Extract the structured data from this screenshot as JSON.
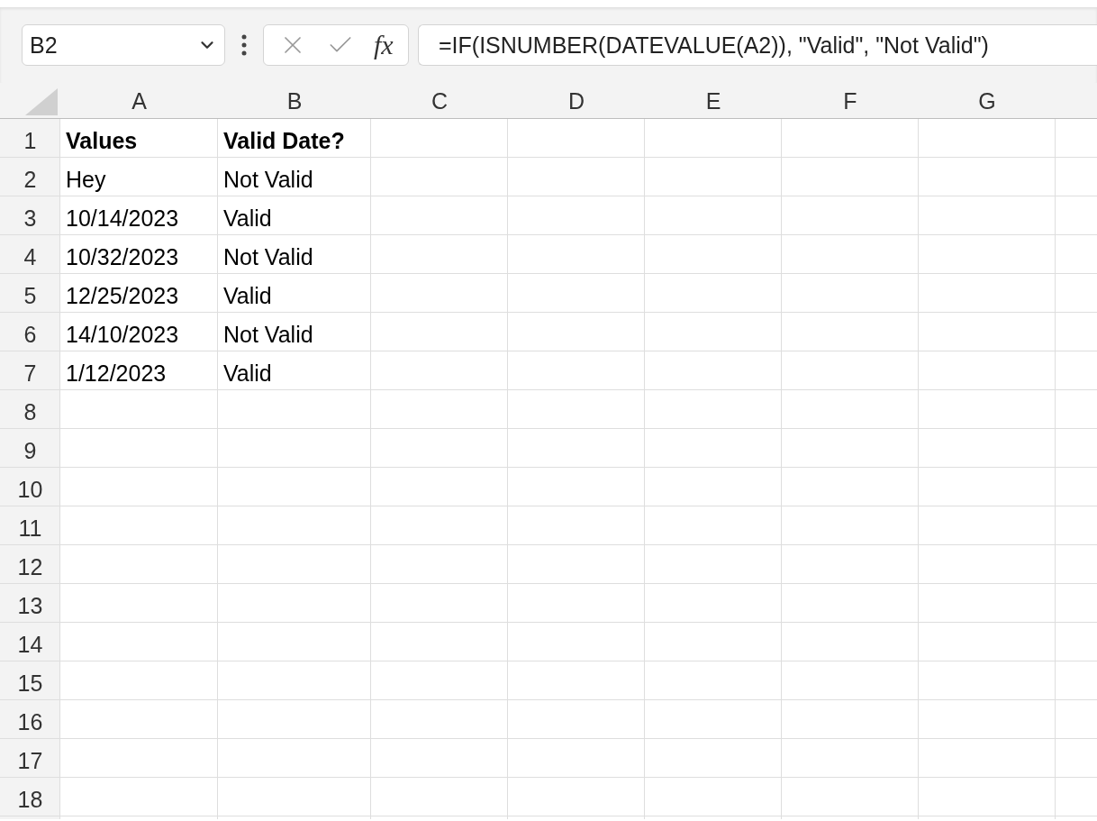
{
  "name_box": {
    "value": "B2"
  },
  "formula_bar": {
    "fx": "fx",
    "value": "=IF(ISNUMBER(DATEVALUE(A2)), \"Valid\", \"Not Valid\")"
  },
  "columns": [
    "A",
    "B",
    "C",
    "D",
    "E",
    "F",
    "G"
  ],
  "rows": [
    {
      "header": "1",
      "cells": [
        {
          "text": "Values",
          "bold": true
        },
        {
          "text": "Valid Date?",
          "bold": true
        }
      ]
    },
    {
      "header": "2",
      "cells": [
        {
          "text": "Hey",
          "bold": false
        },
        {
          "text": "Not Valid",
          "bold": false
        }
      ]
    },
    {
      "header": "3",
      "cells": [
        {
          "text": "10/14/2023",
          "bold": false
        },
        {
          "text": "Valid",
          "bold": false
        }
      ]
    },
    {
      "header": "4",
      "cells": [
        {
          "text": "10/32/2023",
          "bold": false
        },
        {
          "text": "Not Valid",
          "bold": false
        }
      ]
    },
    {
      "header": "5",
      "cells": [
        {
          "text": "12/25/2023",
          "bold": false
        },
        {
          "text": "Valid",
          "bold": false
        }
      ]
    },
    {
      "header": "6",
      "cells": [
        {
          "text": "14/10/2023",
          "bold": false
        },
        {
          "text": "Not Valid",
          "bold": false
        }
      ]
    },
    {
      "header": "7",
      "cells": [
        {
          "text": "1/12/2023",
          "bold": false
        },
        {
          "text": "Valid",
          "bold": false
        }
      ]
    },
    {
      "header": "8"
    },
    {
      "header": "9"
    },
    {
      "header": "10"
    },
    {
      "header": "11"
    },
    {
      "header": "12"
    },
    {
      "header": "13"
    },
    {
      "header": "14"
    },
    {
      "header": "15"
    },
    {
      "header": "16"
    },
    {
      "header": "17"
    },
    {
      "header": "18"
    }
  ]
}
